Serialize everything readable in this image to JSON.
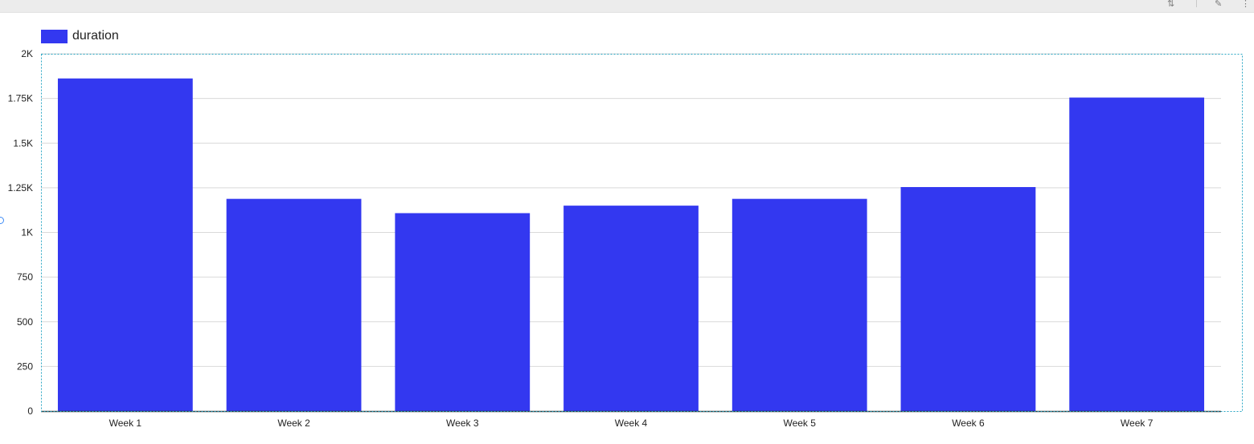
{
  "toolbar": {
    "sort_icon": "sort-az-icon",
    "edit_icon": "pencil-icon",
    "more_icon": "more-vert-icon"
  },
  "colors": {
    "bar": "#3338f0",
    "grid": "#d9d9d9",
    "axis": "#333333",
    "selection_border": "#2aa7c4"
  },
  "chart_data": {
    "type": "bar",
    "categories": [
      "Week 1",
      "Week 2",
      "Week 3",
      "Week 4",
      "Week 5",
      "Week 6",
      "Week 7"
    ],
    "series": [
      {
        "name": "duration",
        "values": [
          1862,
          1188,
          1108,
          1150,
          1188,
          1254,
          1755
        ]
      }
    ],
    "ylim": [
      0,
      2000
    ],
    "yticks": [
      0,
      250,
      500,
      750,
      1000,
      1250,
      1500,
      1750,
      2000
    ],
    "ytick_labels": [
      "0",
      "250",
      "500",
      "750",
      "1K",
      "1.25K",
      "1.5K",
      "1.75K",
      "2K"
    ],
    "xlabel": "",
    "ylabel": "",
    "title": "",
    "grid": true,
    "legend_position": "top-left"
  }
}
